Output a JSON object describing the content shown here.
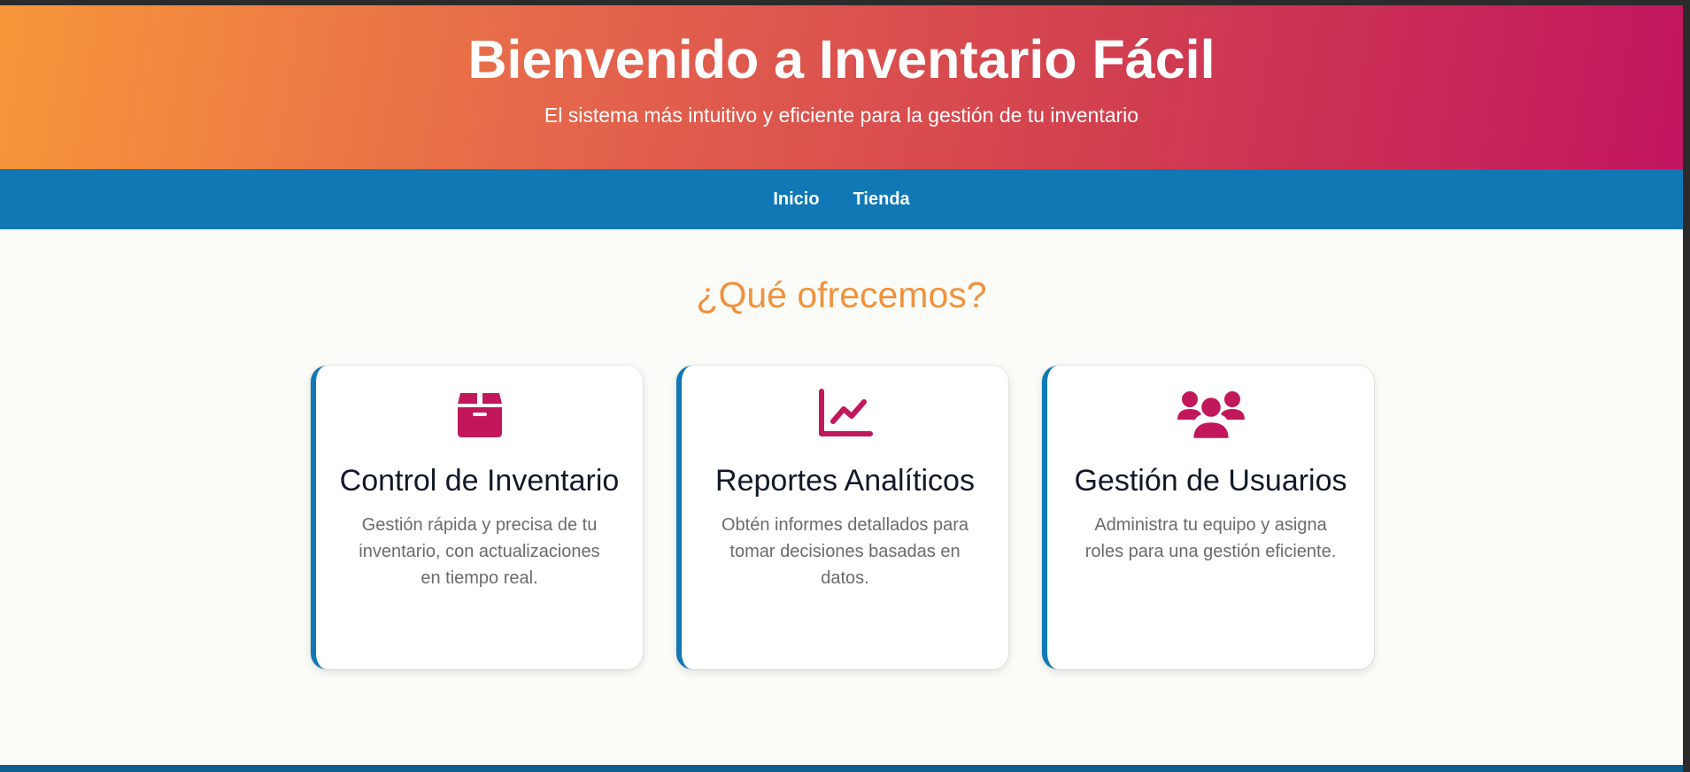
{
  "hero": {
    "title": "Bienvenido a Inventario Fácil",
    "subtitle": "El sistema más intuitivo y eficiente para la gestión de tu inventario"
  },
  "nav": {
    "items": [
      {
        "label": "Inicio"
      },
      {
        "label": "Tienda"
      }
    ]
  },
  "section": {
    "title": "¿Qué ofrecemos?"
  },
  "features": [
    {
      "icon": "box-icon",
      "title": "Control de Inventario",
      "description": "Gestión rápida y precisa de tu inventario, con actualizaciones en tiempo real."
    },
    {
      "icon": "chart-line-icon",
      "title": "Reportes Analíticos",
      "description": "Obtén informes detallados para tomar decisiones basadas en datos."
    },
    {
      "icon": "users-icon",
      "title": "Gestión de Usuarios",
      "description": "Administra tu equipo y asigna roles para una gestión eficiente."
    }
  ],
  "colors": {
    "hero_gradient_start": "#f7973a",
    "hero_gradient_end": "#c1155f",
    "nav_background": "#0f78b5",
    "section_title": "#f0923d",
    "icon_color": "#c2185b",
    "card_accent": "#0f78b5"
  }
}
